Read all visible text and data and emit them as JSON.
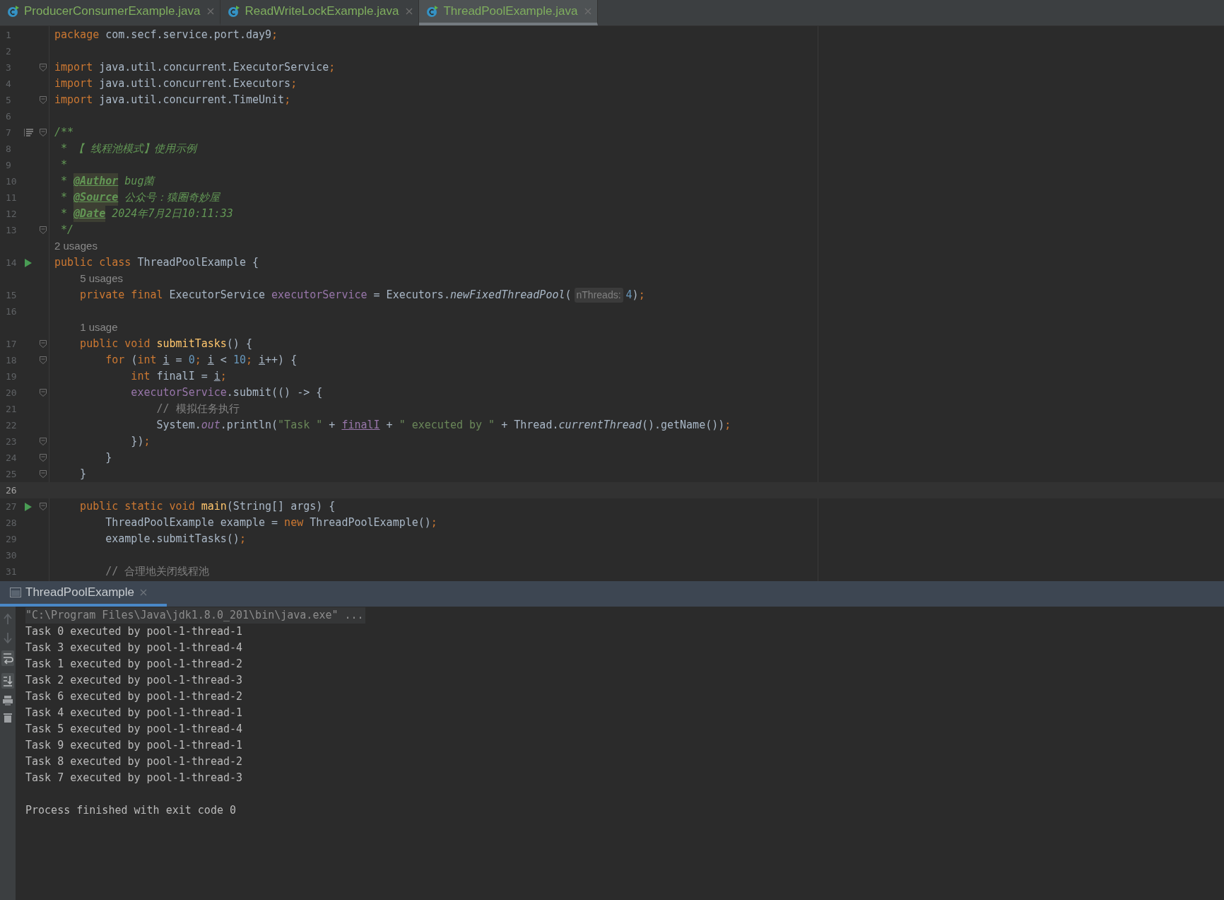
{
  "editor_tabs": [
    {
      "label": "ProducerConsumerExample.java",
      "selected": false
    },
    {
      "label": "ReadWriteLockExample.java",
      "selected": false
    },
    {
      "label": "ThreadPoolExample.java",
      "selected": true
    }
  ],
  "editor": {
    "lines": [
      {
        "kind": "code",
        "number": "1",
        "current": false,
        "run": false,
        "fold": false,
        "doc_toggle": false,
        "tokens": [
          {
            "text": "package",
            "kind": "keyword"
          },
          {
            "text": " com.secf.service.port.day9",
            "kind": "plain"
          },
          {
            "text": ";",
            "kind": "keyword"
          }
        ]
      },
      {
        "kind": "code",
        "number": "2",
        "current": false,
        "run": false,
        "fold": false,
        "doc_toggle": false
      },
      {
        "kind": "code",
        "number": "3",
        "current": false,
        "run": false,
        "fold": true,
        "doc_toggle": false,
        "tokens": [
          {
            "text": "import",
            "kind": "keyword"
          },
          {
            "text": " java.util.concurrent.ExecutorService",
            "kind": "plain"
          },
          {
            "text": ";",
            "kind": "keyword"
          }
        ]
      },
      {
        "kind": "code",
        "number": "4",
        "current": false,
        "run": false,
        "fold": false,
        "doc_toggle": false,
        "tokens": [
          {
            "text": "import",
            "kind": "keyword"
          },
          {
            "text": " java.util.concurrent.Executors",
            "kind": "plain"
          },
          {
            "text": ";",
            "kind": "keyword"
          }
        ]
      },
      {
        "kind": "code",
        "number": "5",
        "current": false,
        "run": false,
        "fold": true,
        "doc_toggle": false,
        "tokens": [
          {
            "text": "import",
            "kind": "keyword"
          },
          {
            "text": " java.util.concurrent.TimeUnit",
            "kind": "plain"
          },
          {
            "text": ";",
            "kind": "keyword"
          }
        ]
      },
      {
        "kind": "code",
        "number": "6",
        "current": false,
        "run": false,
        "fold": false,
        "doc_toggle": false
      },
      {
        "kind": "code",
        "number": "7",
        "current": false,
        "run": false,
        "fold": true,
        "doc_toggle": true,
        "tokens": [
          {
            "text": "/**",
            "kind": "doc"
          }
        ]
      },
      {
        "kind": "code",
        "number": "8",
        "current": false,
        "run": false,
        "fold": false,
        "doc_toggle": false,
        "tokens": [
          {
            "text": " * 【 线程池模式】使用示例",
            "kind": "doc"
          }
        ]
      },
      {
        "kind": "code",
        "number": "9",
        "current": false,
        "run": false,
        "fold": false,
        "doc_toggle": false,
        "tokens": [
          {
            "text": " *",
            "kind": "doc"
          }
        ]
      },
      {
        "kind": "code",
        "number": "10",
        "current": false,
        "run": false,
        "fold": false,
        "doc_toggle": false,
        "tokens": [
          {
            "text": " * ",
            "kind": "doc"
          },
          {
            "text": "@Author",
            "kind": "doctag"
          },
          {
            "text": " bug菌",
            "kind": "doc"
          }
        ]
      },
      {
        "kind": "code",
        "number": "11",
        "current": false,
        "run": false,
        "fold": false,
        "doc_toggle": false,
        "tokens": [
          {
            "text": " * ",
            "kind": "doc"
          },
          {
            "text": "@Source",
            "kind": "doctag"
          },
          {
            "text": " 公众号：猿圈奇妙屋",
            "kind": "doc"
          }
        ]
      },
      {
        "kind": "code",
        "number": "12",
        "current": false,
        "run": false,
        "fold": false,
        "doc_toggle": false,
        "tokens": [
          {
            "text": " * ",
            "kind": "doc"
          },
          {
            "text": "@Date",
            "kind": "doctag"
          },
          {
            "text": " 2024年7月2日10:11:33",
            "kind": "doc"
          }
        ]
      },
      {
        "kind": "code",
        "number": "13",
        "current": false,
        "run": false,
        "fold": true,
        "doc_toggle": false,
        "tokens": [
          {
            "text": " */",
            "kind": "doc"
          }
        ]
      },
      {
        "kind": "hint",
        "text": "2 usages"
      },
      {
        "kind": "code",
        "number": "14",
        "current": false,
        "run": true,
        "fold": false,
        "doc_toggle": false,
        "tokens": [
          {
            "text": "public class ",
            "kind": "keyword"
          },
          {
            "text": "ThreadPoolExample {",
            "kind": "plain"
          }
        ]
      },
      {
        "kind": "hint",
        "text": "    5 usages"
      },
      {
        "kind": "code",
        "number": "15",
        "current": false,
        "run": false,
        "fold": false,
        "doc_toggle": false,
        "tokens": [
          {
            "text": "    private final ",
            "kind": "keyword"
          },
          {
            "text": "ExecutorService ",
            "kind": "plain"
          },
          {
            "text": "executorService",
            "kind": "field"
          },
          {
            "text": " = Executors.",
            "kind": "plain"
          },
          {
            "text": "newFixedThreadPool",
            "kind": "static"
          },
          {
            "text": "(",
            "kind": "plain"
          },
          {
            "text": "nThreads:",
            "kind": "inlay"
          },
          {
            "text": "4",
            "kind": "number"
          },
          {
            "text": ")",
            "kind": "plain"
          },
          {
            "text": ";",
            "kind": "keyword"
          }
        ]
      },
      {
        "kind": "code",
        "number": "16",
        "current": false,
        "run": false,
        "fold": false,
        "doc_toggle": false
      },
      {
        "kind": "hint",
        "text": "    1 usage"
      },
      {
        "kind": "code",
        "number": "17",
        "current": false,
        "run": false,
        "fold": true,
        "doc_toggle": false,
        "tokens": [
          {
            "text": "    public void ",
            "kind": "keyword"
          },
          {
            "text": "submitTasks",
            "kind": "method"
          },
          {
            "text": "() {",
            "kind": "plain"
          }
        ]
      },
      {
        "kind": "code",
        "number": "18",
        "current": false,
        "run": false,
        "fold": true,
        "doc_toggle": false,
        "tokens": [
          {
            "text": "        for ",
            "kind": "keyword"
          },
          {
            "text": "(",
            "kind": "plain"
          },
          {
            "text": "int ",
            "kind": "keyword"
          },
          {
            "text": "i",
            "kind": "reassigned"
          },
          {
            "text": " = ",
            "kind": "plain"
          },
          {
            "text": "0",
            "kind": "number"
          },
          {
            "text": "; ",
            "kind": "keyword"
          },
          {
            "text": "i",
            "kind": "reassigned"
          },
          {
            "text": " < ",
            "kind": "plain"
          },
          {
            "text": "10",
            "kind": "number"
          },
          {
            "text": "; ",
            "kind": "keyword"
          },
          {
            "text": "i",
            "kind": "reassigned"
          },
          {
            "text": "++) {",
            "kind": "plain"
          }
        ]
      },
      {
        "kind": "code",
        "number": "19",
        "current": false,
        "run": false,
        "fold": false,
        "doc_toggle": false,
        "tokens": [
          {
            "text": "            int ",
            "kind": "keyword"
          },
          {
            "text": "finalI = ",
            "kind": "plain"
          },
          {
            "text": "i",
            "kind": "reassigned"
          },
          {
            "text": ";",
            "kind": "keyword"
          }
        ]
      },
      {
        "kind": "code",
        "number": "20",
        "current": false,
        "run": false,
        "fold": true,
        "doc_toggle": false,
        "tokens": [
          {
            "text": "            executorService",
            "kind": "field"
          },
          {
            "text": ".submit(() -> {",
            "kind": "plain"
          }
        ]
      },
      {
        "kind": "code",
        "number": "21",
        "current": false,
        "run": false,
        "fold": false,
        "doc_toggle": false,
        "tokens": [
          {
            "text": "                // 模拟任务执行",
            "kind": "comment"
          }
        ]
      },
      {
        "kind": "code",
        "number": "22",
        "current": false,
        "run": false,
        "fold": false,
        "doc_toggle": false,
        "tokens": [
          {
            "text": "                System.",
            "kind": "plain"
          },
          {
            "text": "out",
            "kind": "static_field"
          },
          {
            "text": ".println(",
            "kind": "plain"
          },
          {
            "text": "\"Task \"",
            "kind": "string"
          },
          {
            "text": " + ",
            "kind": "plain"
          },
          {
            "text": "finalI",
            "kind": "captured"
          },
          {
            "text": " + ",
            "kind": "plain"
          },
          {
            "text": "\" executed by \"",
            "kind": "string"
          },
          {
            "text": " + Thread.",
            "kind": "plain"
          },
          {
            "text": "currentThread",
            "kind": "static"
          },
          {
            "text": "().getName())",
            "kind": "plain"
          },
          {
            "text": ";",
            "kind": "keyword"
          }
        ]
      },
      {
        "kind": "code",
        "number": "23",
        "current": false,
        "run": false,
        "fold": true,
        "doc_toggle": false,
        "tokens": [
          {
            "text": "            })",
            "kind": "plain"
          },
          {
            "text": ";",
            "kind": "keyword"
          }
        ]
      },
      {
        "kind": "code",
        "number": "24",
        "current": false,
        "run": false,
        "fold": true,
        "doc_toggle": false,
        "tokens": [
          {
            "text": "        }",
            "kind": "plain"
          }
        ]
      },
      {
        "kind": "code",
        "number": "25",
        "current": false,
        "run": false,
        "fold": true,
        "doc_toggle": false,
        "tokens": [
          {
            "text": "    }",
            "kind": "plain"
          }
        ]
      },
      {
        "kind": "code",
        "number": "26",
        "current": true,
        "run": false,
        "fold": false,
        "doc_toggle": false
      },
      {
        "kind": "code",
        "number": "27",
        "current": false,
        "run": true,
        "fold": true,
        "doc_toggle": false,
        "tokens": [
          {
            "text": "    public static void ",
            "kind": "keyword"
          },
          {
            "text": "main",
            "kind": "method"
          },
          {
            "text": "(String[] args) {",
            "kind": "plain"
          }
        ]
      },
      {
        "kind": "code",
        "number": "28",
        "current": false,
        "run": false,
        "fold": false,
        "doc_toggle": false,
        "tokens": [
          {
            "text": "        ThreadPoolExample example = ",
            "kind": "plain"
          },
          {
            "text": "new ",
            "kind": "keyword"
          },
          {
            "text": "ThreadPoolExample()",
            "kind": "plain"
          },
          {
            "text": ";",
            "kind": "keyword"
          }
        ]
      },
      {
        "kind": "code",
        "number": "29",
        "current": false,
        "run": false,
        "fold": false,
        "doc_toggle": false,
        "tokens": [
          {
            "text": "        example.submitTasks()",
            "kind": "plain"
          },
          {
            "text": ";",
            "kind": "keyword"
          }
        ]
      },
      {
        "kind": "code",
        "number": "30",
        "current": false,
        "run": false,
        "fold": false,
        "doc_toggle": false
      },
      {
        "kind": "code",
        "number": "31",
        "current": false,
        "run": false,
        "fold": false,
        "doc_toggle": false,
        "tokens": [
          {
            "text": "        // 合理地关闭线程池",
            "kind": "comment"
          }
        ]
      }
    ]
  },
  "run_panel": {
    "tab": {
      "label": "ThreadPoolExample",
      "selected": true
    },
    "output": [
      {
        "kind": "command",
        "text": "\"C:\\Program Files\\Java\\jdk1.8.0_201\\bin\\java.exe\" ..."
      },
      {
        "kind": "output",
        "text": "Task 0 executed by pool-1-thread-1"
      },
      {
        "kind": "output",
        "text": "Task 3 executed by pool-1-thread-4"
      },
      {
        "kind": "output",
        "text": "Task 1 executed by pool-1-thread-2"
      },
      {
        "kind": "output",
        "text": "Task 2 executed by pool-1-thread-3"
      },
      {
        "kind": "output",
        "text": "Task 6 executed by pool-1-thread-2"
      },
      {
        "kind": "output",
        "text": "Task 4 executed by pool-1-thread-1"
      },
      {
        "kind": "output",
        "text": "Task 5 executed by pool-1-thread-4"
      },
      {
        "kind": "output",
        "text": "Task 9 executed by pool-1-thread-1"
      },
      {
        "kind": "output",
        "text": "Task 8 executed by pool-1-thread-2"
      },
      {
        "kind": "output",
        "text": "Task 7 executed by pool-1-thread-3"
      },
      {
        "kind": "exit",
        "text": "Process finished with exit code 0"
      }
    ]
  }
}
